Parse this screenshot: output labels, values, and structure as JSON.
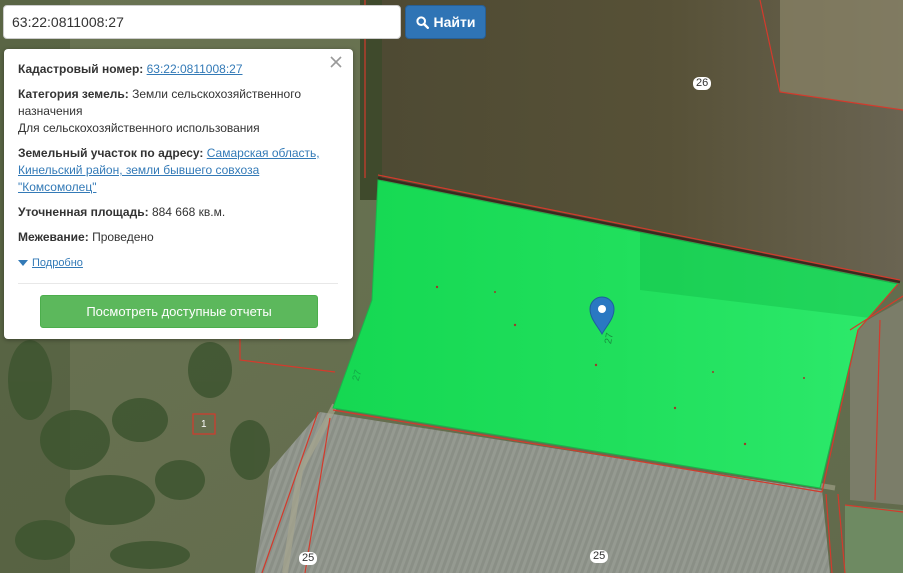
{
  "search": {
    "value": "63:22:0811008:27",
    "button_label": "Найти"
  },
  "card": {
    "cadastral": {
      "label": "Кадастровый номер:",
      "value": "63:22:0811008:27"
    },
    "category": {
      "label": "Категория земель:",
      "value_line1": "Земли сельскохозяйственного",
      "value_line2": "назначения",
      "use": "Для сельскохозяйственного использования"
    },
    "address": {
      "label": "Земельный участок по адресу:",
      "line1": "Самарская область,",
      "line2": "Кинельский район, земли бывшего совхоза",
      "line3": "\"Комсомолец\""
    },
    "area": {
      "label": "Уточненная площадь:",
      "value": "884 668 кв.м."
    },
    "survey": {
      "label": "Межевание:",
      "value": "Проведено"
    },
    "more_label": "Подробно",
    "report_button": "Посмотреть доступные отчеты"
  },
  "map": {
    "parcel_labels": {
      "top_right": "26",
      "parcel": "27",
      "small": "1",
      "bottom_left": "25",
      "bottom_center": "25"
    },
    "colors": {
      "parcel_fill": "#1de05a",
      "boundary": "#d43a2c",
      "marker": "#2a78c2"
    }
  }
}
